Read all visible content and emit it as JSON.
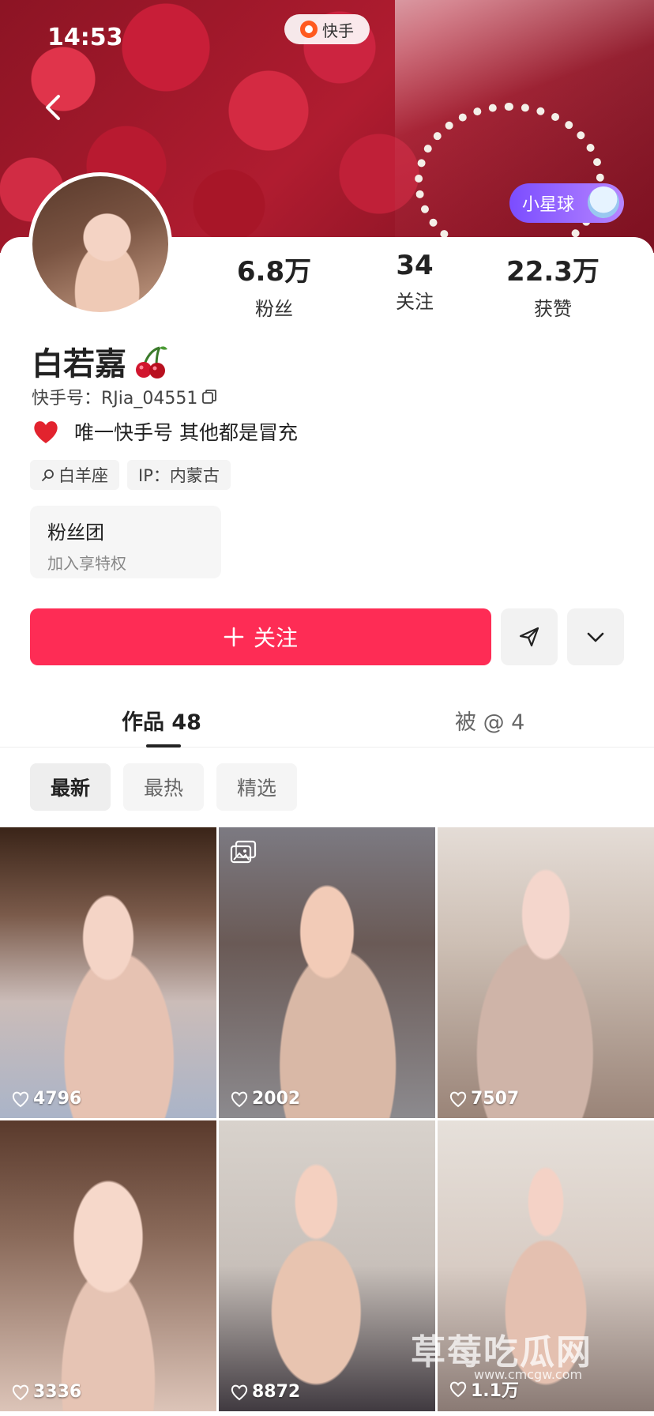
{
  "status_bar": {
    "time": "14:53"
  },
  "app_pill": {
    "label": "快手"
  },
  "xingqiu_badge": {
    "label": "小星球"
  },
  "profile": {
    "stats": [
      {
        "value": "6.8万",
        "label": "粉丝"
      },
      {
        "value": "34",
        "label": "关注"
      },
      {
        "value": "22.3万",
        "label": "获赞"
      }
    ],
    "nickname": "白若嘉",
    "kuaishou_id": "快手号：RJia_04551",
    "bio": "唯一快手号 其他都是冒充",
    "tags": [
      {
        "label": "白羊座"
      },
      {
        "label": "IP：内蒙古"
      }
    ],
    "fans_club": {
      "title": "粉丝团",
      "subtitle": "加入享特权"
    }
  },
  "actions": {
    "follow_label": "关注"
  },
  "tabs": [
    {
      "label": "作品 48",
      "active": true
    },
    {
      "label": "被 @ 4",
      "active": false
    }
  ],
  "filters": [
    {
      "label": "最新",
      "active": true
    },
    {
      "label": "最热",
      "active": false
    },
    {
      "label": "精选",
      "active": false
    }
  ],
  "videos": [
    {
      "likes": "4796",
      "is_album": false
    },
    {
      "likes": "2002",
      "is_album": true
    },
    {
      "likes": "7507",
      "is_album": false
    },
    {
      "likes": "3336",
      "is_album": false
    },
    {
      "likes": "8872",
      "is_album": false
    },
    {
      "likes": "1.1万",
      "is_album": false
    }
  ],
  "watermark": {
    "text": "草莓吃瓜网",
    "url": "www.cmcgw.com"
  },
  "colors": {
    "accent": "#fe2c55",
    "badge": "#7b4dff"
  }
}
